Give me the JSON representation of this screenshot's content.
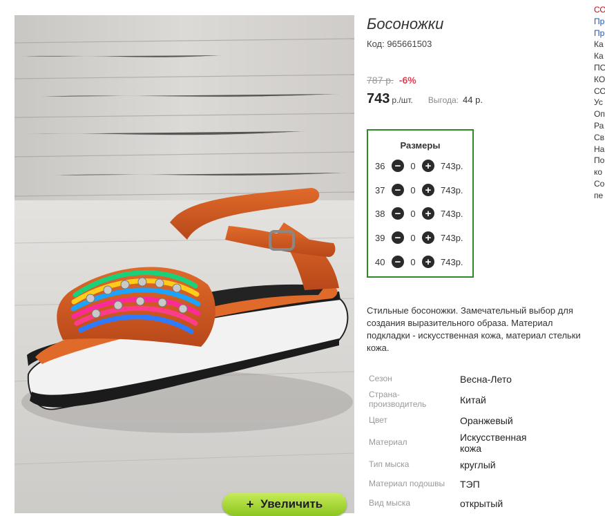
{
  "product": {
    "title": "Босоножки",
    "code": "Код: 965661503",
    "old_price": "787 р.",
    "discount": "-6%",
    "price": "743",
    "price_unit": "р./шт.",
    "saving_label": "Выгода:",
    "saving_value": "44 р."
  },
  "zoom_button": {
    "plus": "+",
    "label": "Увеличить"
  },
  "sizes": {
    "title": "Размеры",
    "items": [
      {
        "size": "36",
        "qty": "0",
        "price": "743р."
      },
      {
        "size": "37",
        "qty": "0",
        "price": "743р."
      },
      {
        "size": "38",
        "qty": "0",
        "price": "743р."
      },
      {
        "size": "39",
        "qty": "0",
        "price": "743р."
      },
      {
        "size": "40",
        "qty": "0",
        "price": "743р."
      }
    ]
  },
  "description": "Стильные босоножки. Замечательный выбор для создания выразительного образа. Материал подкладки - искусственная кожа, материал стельки кожа.",
  "properties": [
    {
      "label": "Сезон",
      "value": "Весна-Лето"
    },
    {
      "label": "Страна-производитель",
      "value": "Китай"
    },
    {
      "label": "Цвет",
      "value": "Оранжевый"
    },
    {
      "label": "Материал",
      "value": "Искусственная кожа"
    },
    {
      "label": "Тип мыска",
      "value": "круглый"
    },
    {
      "label": "Материал подошвы",
      "value": "ТЭП"
    },
    {
      "label": "Вид мыска",
      "value": "открытый"
    }
  ],
  "side_links": [
    "СО",
    "Пр",
    "Пр",
    "Ка",
    "Ка",
    "ПО",
    "КО",
    "СО",
    "Ус",
    "Оп",
    "Ра",
    "Св",
    "На",
    "По",
    "ко",
    "Со",
    "пе"
  ],
  "colors": {
    "accent_green": "#2c8a26",
    "discount_red": "#e53e55",
    "button_green": "#8bc51f"
  },
  "icons": {
    "minus": "minus-circle-icon",
    "plus": "plus-circle-icon"
  }
}
